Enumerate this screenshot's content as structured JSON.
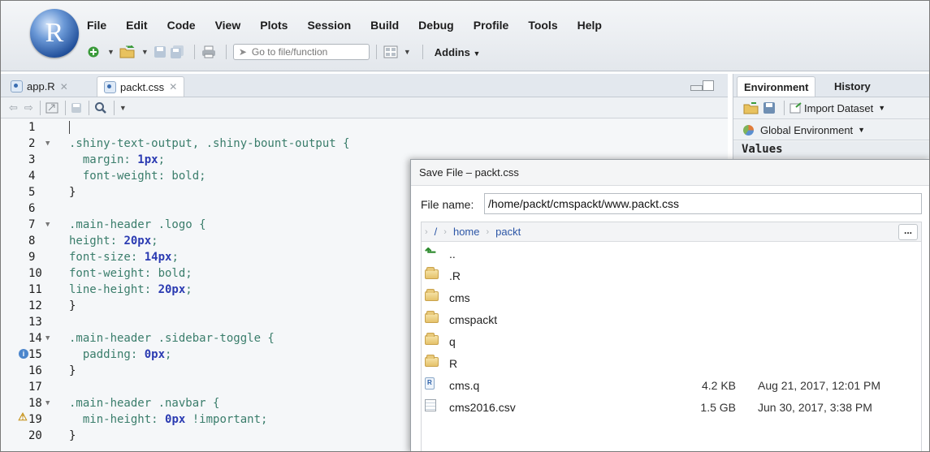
{
  "menu": [
    "File",
    "Edit",
    "Code",
    "View",
    "Plots",
    "Session",
    "Build",
    "Debug",
    "Profile",
    "Tools",
    "Help"
  ],
  "toolbar": {
    "goto_placeholder": "Go to file/function",
    "addins": "Addins"
  },
  "logo_letter": "R",
  "editor": {
    "tabs": [
      {
        "label": "app.R"
      },
      {
        "label": "packt.css"
      }
    ],
    "lines": [
      {
        "n": "1",
        "text": ""
      },
      {
        "n": "2",
        "text": ".shiny-text-output, .shiny-bount-output {"
      },
      {
        "n": "3",
        "text": "  margin: 1px;"
      },
      {
        "n": "4",
        "text": "  font-weight: bold;"
      },
      {
        "n": "5",
        "text": "}"
      },
      {
        "n": "6",
        "text": ""
      },
      {
        "n": "7",
        "text": ".main-header .logo {"
      },
      {
        "n": "8",
        "text": "height: 20px;"
      },
      {
        "n": "9",
        "text": "font-size: 14px;"
      },
      {
        "n": "10",
        "text": "font-weight: bold;"
      },
      {
        "n": "11",
        "text": "line-height: 20px;"
      },
      {
        "n": "12",
        "text": "}"
      },
      {
        "n": "13",
        "text": ""
      },
      {
        "n": "14",
        "text": ".main-header .sidebar-toggle {"
      },
      {
        "n": "15",
        "text": "  padding: 0px;"
      },
      {
        "n": "16",
        "text": "}"
      },
      {
        "n": "17",
        "text": ""
      },
      {
        "n": "18",
        "text": ".main-header .navbar {"
      },
      {
        "n": "19",
        "text": "  min-height: 0px !important;"
      },
      {
        "n": "20",
        "text": "}"
      }
    ]
  },
  "right_pane": {
    "tabs": [
      "Environment",
      "History"
    ],
    "import_label": "Import Dataset",
    "env_label": "Global Environment",
    "values_header": "Values"
  },
  "dialog": {
    "title": "Save File – packt.css",
    "file_name_label": "File name:",
    "file_name_value": "/home/packt/cmspackt/www.packt.css",
    "breadcrumb": [
      "/",
      "home",
      "packt"
    ],
    "more_label": "...",
    "files": [
      {
        "name": "..",
        "type": "up",
        "size": "",
        "date": ""
      },
      {
        "name": ".R",
        "type": "folder",
        "size": "",
        "date": ""
      },
      {
        "name": "cms",
        "type": "folder",
        "size": "",
        "date": ""
      },
      {
        "name": "cmspackt",
        "type": "folder",
        "size": "",
        "date": ""
      },
      {
        "name": "q",
        "type": "folder",
        "size": "",
        "date": ""
      },
      {
        "name": "R",
        "type": "folder",
        "size": "",
        "date": ""
      },
      {
        "name": "cms.q",
        "type": "r-file",
        "size": "4.2 KB",
        "date": "Aug 21, 2017, 12:01 PM"
      },
      {
        "name": "cms2016.csv",
        "type": "csv-file",
        "size": "1.5 GB",
        "date": "Jun 30, 2017, 3:38 PM"
      }
    ]
  }
}
